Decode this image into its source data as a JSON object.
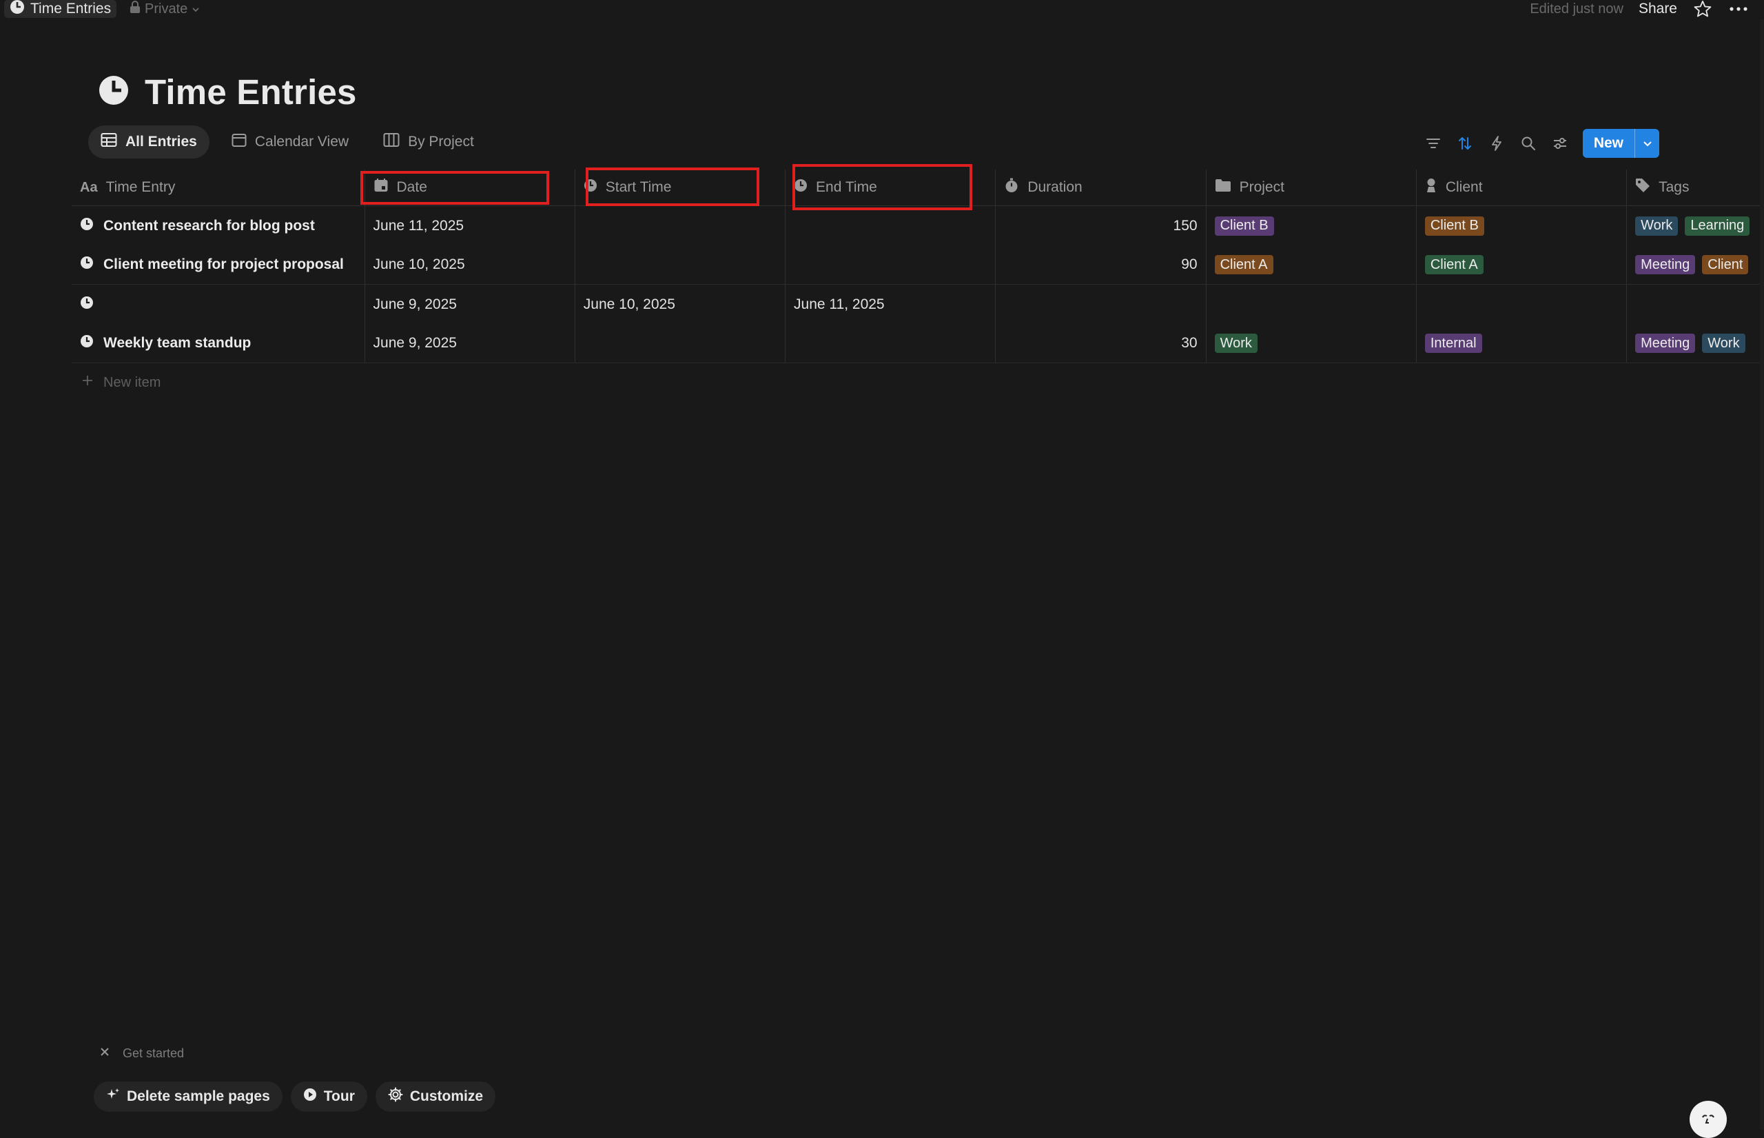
{
  "topbar": {
    "page_name": "Time Entries",
    "privacy": "Private",
    "edited": "Edited just now",
    "share": "Share"
  },
  "page": {
    "title": "Time Entries"
  },
  "views": [
    {
      "label": "All Entries",
      "icon": "table-icon",
      "active": true
    },
    {
      "label": "Calendar View",
      "icon": "calendar-icon",
      "active": false
    },
    {
      "label": "By Project",
      "icon": "board-icon",
      "active": false
    }
  ],
  "toolbar": {
    "new_label": "New"
  },
  "columns": [
    {
      "label": "Time Entry",
      "icon": "text-aa-icon"
    },
    {
      "label": "Date",
      "icon": "calendar-icon"
    },
    {
      "label": "Start Time",
      "icon": "clock-icon"
    },
    {
      "label": "End Time",
      "icon": "clock-icon"
    },
    {
      "label": "Duration",
      "icon": "stopwatch-icon"
    },
    {
      "label": "Project",
      "icon": "folder-icon"
    },
    {
      "label": "Client",
      "icon": "person-icon"
    },
    {
      "label": "Tags",
      "icon": "tag-icon"
    }
  ],
  "rows": [
    {
      "title": "Content research for blog post",
      "date": "June 11, 2025",
      "start": "",
      "end": "",
      "duration": "150",
      "project": {
        "label": "Client B",
        "color": "purple"
      },
      "client": {
        "label": "Client B",
        "color": "orange"
      },
      "tags": [
        {
          "label": "Work",
          "color": "blue"
        },
        {
          "label": "Learning",
          "color": "green"
        }
      ]
    },
    {
      "title": "Client meeting for project proposal",
      "date": "June 10, 2025",
      "start": "",
      "end": "",
      "duration": "90",
      "project": {
        "label": "Client A",
        "color": "orange"
      },
      "client": {
        "label": "Client A",
        "color": "green"
      },
      "tags": [
        {
          "label": "Meeting",
          "color": "purple"
        },
        {
          "label": "Client",
          "color": "orange"
        }
      ]
    },
    {
      "title": "",
      "date": "June 9, 2025",
      "start": "June 10, 2025",
      "end": "June 11, 2025",
      "duration": "",
      "project": null,
      "client": null,
      "tags": []
    },
    {
      "title": "Weekly team standup",
      "date": "June 9, 2025",
      "start": "",
      "end": "",
      "duration": "30",
      "project": {
        "label": "Work",
        "color": "green"
      },
      "client": {
        "label": "Internal",
        "color": "purple"
      },
      "tags": [
        {
          "label": "Meeting",
          "color": "purple"
        },
        {
          "label": "Work",
          "color": "blue"
        }
      ]
    }
  ],
  "new_item_label": "New item",
  "get_started": {
    "label": "Get started",
    "buttons": [
      {
        "label": "Delete sample pages",
        "icon": "sparkle-icon"
      },
      {
        "label": "Tour",
        "icon": "play-icon"
      },
      {
        "label": "Customize",
        "icon": "gear-icon"
      }
    ]
  },
  "colors": {
    "background": "#191919",
    "accent": "#2383e2",
    "highlight": "#e0201e"
  }
}
